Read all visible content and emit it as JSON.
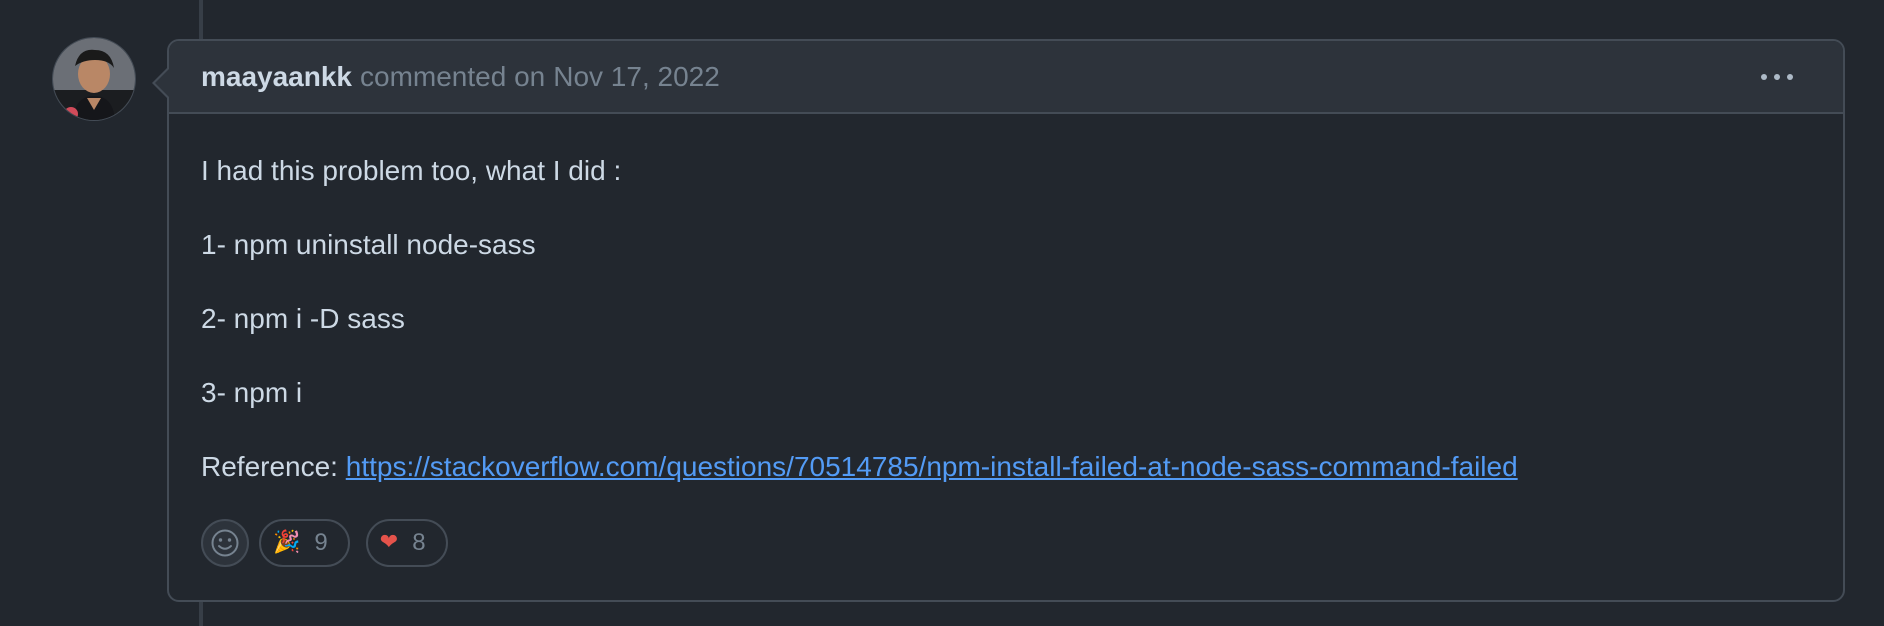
{
  "comment": {
    "author": "maayaankk",
    "action_text": "commented on",
    "date": "Nov 17, 2022",
    "more_icon": "kebab-horizontal-icon",
    "body": {
      "line1": "I had this problem too, what I did :",
      "line2": "1- npm uninstall node-sass",
      "line3": "2- npm i -D sass",
      "line4": "3- npm i",
      "reference_label": "Reference: ",
      "reference_link": "https://stackoverflow.com/questions/70514785/npm-install-failed-at-node-sass-command-failed"
    },
    "reactions": {
      "add_icon": "smiley-icon",
      "items": [
        {
          "icon": "party-popper-icon",
          "emoji": "🎉",
          "count": "9"
        },
        {
          "icon": "heart-icon",
          "emoji": "❤",
          "count": "8"
        }
      ]
    }
  },
  "colors": {
    "background": "#22272e",
    "header_background": "#2d333b",
    "border": "#444c56",
    "text": "#cdd9e5",
    "muted": "#768390",
    "link": "#539bf5",
    "heart": "#e5534b"
  }
}
